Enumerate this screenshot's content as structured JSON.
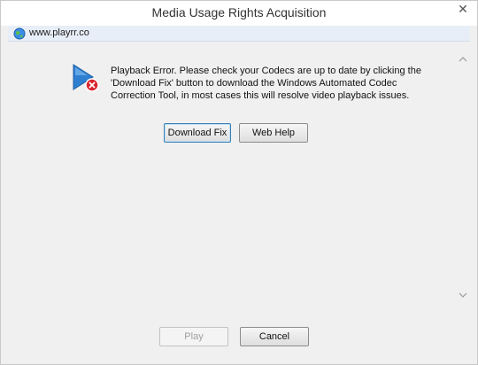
{
  "window": {
    "title": "Media Usage Rights Acquisition",
    "close_glyph": "✕"
  },
  "address": {
    "url": "www.playrr.co"
  },
  "dialog": {
    "message": "Playback Error. Please check your Codecs are up to date by clicking the 'Download Fix' button to download the Windows Automated Codec Correction Tool, in most cases this will resolve video playback issues.",
    "download_label": "Download Fix",
    "webhelp_label": "Web Help"
  },
  "footer": {
    "play_label": "Play",
    "cancel_label": "Cancel"
  },
  "colors": {
    "accent": "#3c7fb1",
    "error": "#d9262f",
    "media_icon": "#2f7fd1"
  }
}
